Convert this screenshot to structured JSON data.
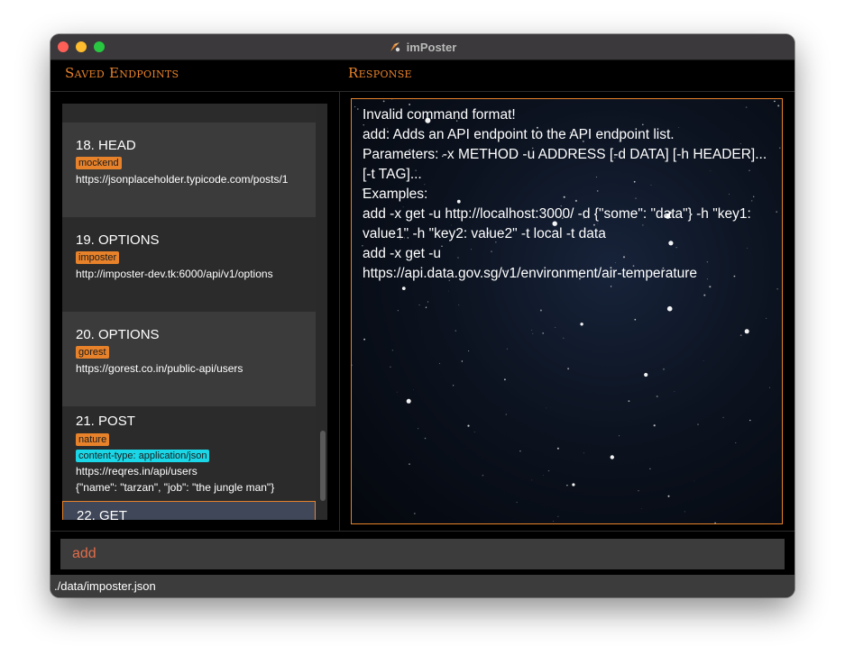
{
  "window": {
    "title": "imPoster"
  },
  "left_panel": {
    "header": "Saved Endpoints",
    "endpoints": [
      {
        "title": "18.  HEAD",
        "tags": [
          "mockend"
        ],
        "url": "https://jsonplaceholder.typicode.com/posts/1"
      },
      {
        "title": "19.  OPTIONS",
        "tags": [
          "imposter"
        ],
        "url": "http://imposter-dev.tk:6000/api/v1/options"
      },
      {
        "title": "20.  OPTIONS",
        "tags": [
          "gorest"
        ],
        "url": "https://gorest.co.in/public-api/users"
      },
      {
        "title": "21.  POST",
        "tags": [
          "nature",
          "content-type: application/json"
        ],
        "url": "https://reqres.in/api/users",
        "data": "{\"name\": \"tarzan\", \"job\": \"the jungle man\"}"
      },
      {
        "title": "22.  GET"
      }
    ]
  },
  "right_panel": {
    "header": "Response",
    "response_text": "Invalid command format!\nadd: Adds an API endpoint to the API endpoint list.\nParameters: -x METHOD -u ADDRESS [-d DATA] [-h HEADER]... [-t TAG]...\nExamples:\nadd -x get -u http://localhost:3000/ -d {\"some\": \"data\"} -h \"key1: value1\" -h \"key2: value2\" -t local -t data\nadd -x get -u\nhttps://api.data.gov.sg/v1/environment/air-temperature"
  },
  "command_box": {
    "value": "add"
  },
  "status_bar": {
    "path": "./data/imposter.json"
  },
  "colors": {
    "accent": "#e8822a",
    "tag_orange": "#e8822a",
    "tag_cyan": "#1ad6e6",
    "command_text": "#e06d4a"
  }
}
